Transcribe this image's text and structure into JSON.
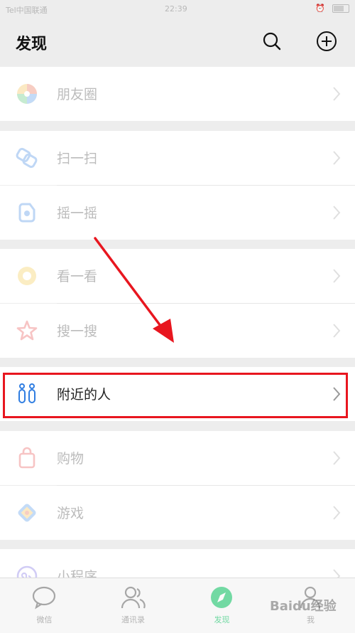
{
  "status_bar": {
    "carrier": "Tel中国联通",
    "time": "22:39"
  },
  "header": {
    "title": "发现"
  },
  "menu": [
    {
      "label": "朋友圈",
      "icon": "moments-icon"
    },
    {
      "label": "扫一扫",
      "icon": "scan-icon"
    },
    {
      "label": "摇一摇",
      "icon": "shake-icon"
    },
    {
      "label": "看一看",
      "icon": "top-stories-icon"
    },
    {
      "label": "搜一搜",
      "icon": "search-star-icon"
    },
    {
      "label": "附近的人",
      "icon": "people-nearby-icon"
    },
    {
      "label": "购物",
      "icon": "shopping-bag-icon"
    },
    {
      "label": "游戏",
      "icon": "games-icon"
    },
    {
      "label": "小程序",
      "icon": "mini-programs-icon"
    }
  ],
  "tabs": [
    {
      "label": "微信",
      "icon": "chat-icon"
    },
    {
      "label": "通讯录",
      "icon": "contacts-icon"
    },
    {
      "label": "发现",
      "icon": "compass-icon",
      "active": true
    },
    {
      "label": "我",
      "icon": "me-icon"
    }
  ],
  "watermark": "Baidu经验",
  "colors": {
    "accent": "#07c160",
    "highlight": "#e8161f",
    "arrow": "#e8161f"
  }
}
